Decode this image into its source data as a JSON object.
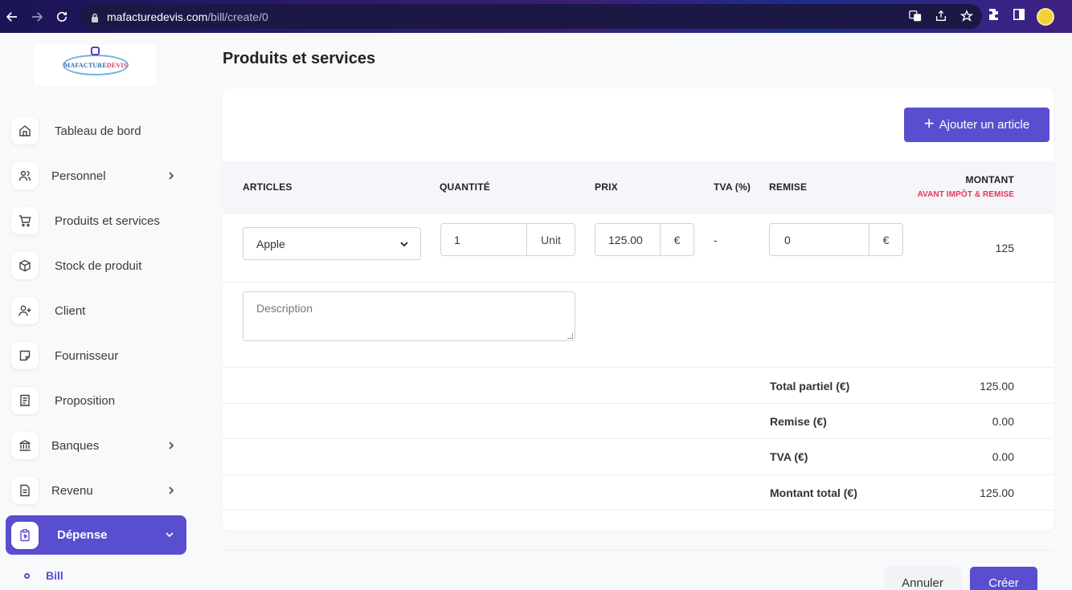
{
  "browser": {
    "url_host": "mafacturedevis.com",
    "url_path": "/bill/create/0",
    "icons": [
      "back-icon",
      "forward-icon",
      "reload-icon",
      "lock-icon",
      "translate-icon",
      "share-icon",
      "star-icon",
      "extensions-icon",
      "sidebar-icon",
      "profile-avatar"
    ]
  },
  "logo": {
    "text_a": "MAFACTURE",
    "text_b": "DEVIS"
  },
  "sidebar": {
    "items": [
      {
        "label": "Tableau de bord",
        "icon": "home-icon"
      },
      {
        "label": "Personnel",
        "icon": "users-icon",
        "has_children": true
      },
      {
        "label": "Produits et services",
        "icon": "cart-icon"
      },
      {
        "label": "Stock de produit",
        "icon": "box-icon"
      },
      {
        "label": "Client",
        "icon": "user-plus-icon"
      },
      {
        "label": "Fournisseur",
        "icon": "note-icon"
      },
      {
        "label": "Proposition",
        "icon": "receipt-icon"
      },
      {
        "label": "Banques",
        "icon": "bank-icon",
        "has_children": true
      },
      {
        "label": "Revenu",
        "icon": "file-icon",
        "has_children": true
      }
    ],
    "active": {
      "label": "Dépense",
      "icon": "clipboard-icon",
      "expanded": true
    },
    "sub_items": [
      {
        "label": "Bill"
      }
    ]
  },
  "main": {
    "title": "Produits et services",
    "add_button": "Ajouter un article",
    "columns": {
      "articles": "ARTICLES",
      "quantite": "QUANTITÉ",
      "prix": "PRIX",
      "tva": "TVA (%)",
      "remise": "REMISE",
      "montant": "MONTANT",
      "montant_sub": "AVANT IMPÔT & REMISE"
    },
    "row": {
      "article": "Apple",
      "quantity": "1",
      "unit": "Unit",
      "price": "125.00",
      "price_currency": "€",
      "tva": "-",
      "discount": "0",
      "discount_currency": "€",
      "amount": "125"
    },
    "description_placeholder": "Description",
    "totals": [
      {
        "label": "Total partiel (€)",
        "value": "125.00"
      },
      {
        "label": "Remise (€)",
        "value": "0.00"
      },
      {
        "label": "TVA (€)",
        "value": "0.00"
      },
      {
        "label": "Montant total (€)",
        "value": "125.00"
      }
    ],
    "cancel_button": "Annuler",
    "create_button": "Créer"
  },
  "colors": {
    "accent": "#5a4ed0",
    "highlight": "#e8345a"
  }
}
